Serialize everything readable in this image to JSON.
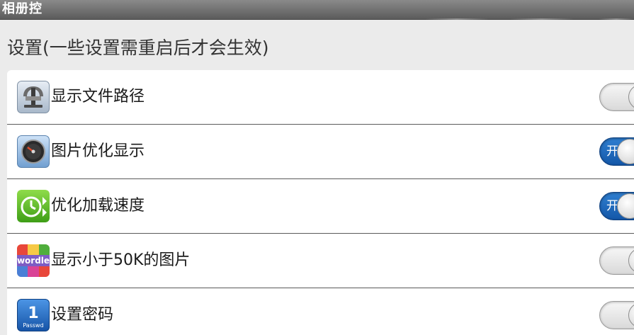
{
  "app": {
    "title": "相册控"
  },
  "settings": {
    "header": "设置(一些设置需重启后才会生效)",
    "items": [
      {
        "label": "显示文件路径",
        "icon": "path-icon",
        "enabled": false,
        "on_text": ""
      },
      {
        "label": "图片优化显示",
        "icon": "speedometer-icon",
        "enabled": true,
        "on_text": "开"
      },
      {
        "label": "优化加载速度",
        "icon": "clock-icon",
        "enabled": true,
        "on_text": "开"
      },
      {
        "label": "显示小于50K的图片",
        "icon": "wordle-icon",
        "enabled": false,
        "on_text": ""
      },
      {
        "label": "设置密码",
        "icon": "password-icon",
        "enabled": false,
        "on_text": ""
      }
    ],
    "password_icon_text": {
      "digit": "1",
      "caption": "Passwd"
    },
    "wordle_icon_text": "wordle"
  },
  "colors": {
    "titlebar": "#6e6e6e",
    "background": "#ebebeb",
    "toggle_on": "#1f6bc0",
    "toggle_off": "#e6e6e6"
  }
}
